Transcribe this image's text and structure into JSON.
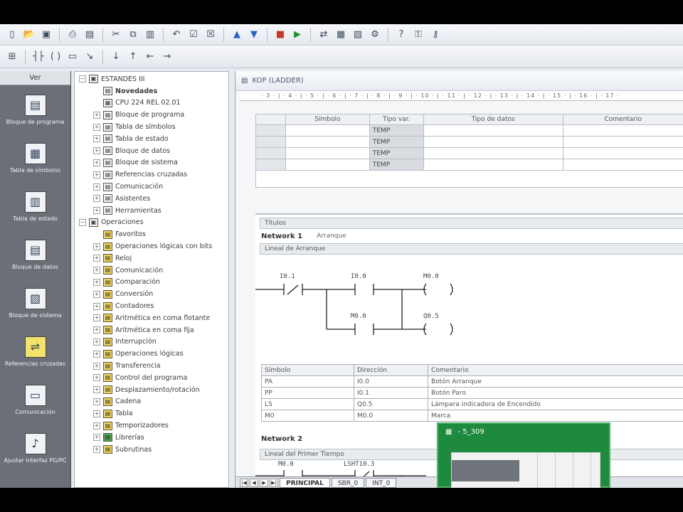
{
  "toolbar1": {
    "icons": [
      "new-icon",
      "open-icon",
      "save-icon",
      "print-icon",
      "preview-icon",
      "cut-icon",
      "copy-icon",
      "paste-icon",
      "undo-icon",
      "compile-icon",
      "compile-all-icon",
      "upload-icon",
      "download-icon",
      "stop-icon",
      "run-icon",
      "status-icon",
      "monitor-icon",
      "chart-icon",
      "options-icon",
      "help-icon",
      "lock-icon",
      "key-icon"
    ]
  },
  "toolbar2": {
    "icons": [
      "network-icon",
      "contact-icon",
      "coil-icon",
      "box-icon",
      "wire-icon",
      "down-line-icon",
      "up-line-icon",
      "left-line-icon",
      "right-line-icon"
    ]
  },
  "leftbar": {
    "header": "Ver",
    "items": [
      {
        "label": "Bloque de programa",
        "icon": "program-block-icon"
      },
      {
        "label": "Tabla de símbolos",
        "icon": "symbol-table-icon"
      },
      {
        "label": "Tabla de estado",
        "icon": "status-table-icon"
      },
      {
        "label": "Bloque de datos",
        "icon": "data-block-icon"
      },
      {
        "label": "Bloque de sistema",
        "icon": "system-block-icon"
      },
      {
        "label": "Referencias cruzadas",
        "icon": "cross-reference-icon"
      },
      {
        "label": "Comunicación",
        "icon": "communication-icon"
      },
      {
        "label": "Ajustar interfaz PG/PC",
        "icon": "pgpc-interface-icon"
      }
    ]
  },
  "tree": {
    "items": [
      {
        "text": "ESTANDES III",
        "exp": "⊟",
        "ico": "▣",
        "bold": false,
        "indent": 0
      },
      {
        "text": "Novedades",
        "exp": "",
        "ico": "▤",
        "bold": true,
        "indent": 1
      },
      {
        "text": "CPU 224 REL 02.01",
        "exp": "",
        "ico": "▦",
        "bold": false,
        "indent": 1
      },
      {
        "text": "Bloque de programa",
        "exp": "⊞",
        "ico": "▤",
        "bold": false,
        "indent": 1
      },
      {
        "text": "Tabla de símbolos",
        "exp": "⊞",
        "ico": "▤",
        "bold": false,
        "indent": 1
      },
      {
        "text": "Tabla de estado",
        "exp": "⊞",
        "ico": "▤",
        "bold": false,
        "indent": 1
      },
      {
        "text": "Bloque de datos",
        "exp": "⊞",
        "ico": "▤",
        "bold": false,
        "indent": 1
      },
      {
        "text": "Bloque de sistema",
        "exp": "⊞",
        "ico": "▤",
        "bold": false,
        "indent": 1
      },
      {
        "text": "Referencias cruzadas",
        "exp": "⊞",
        "ico": "▤",
        "bold": false,
        "indent": 1
      },
      {
        "text": "Comunicación",
        "exp": "⊞",
        "ico": "▤",
        "bold": false,
        "indent": 1
      },
      {
        "text": "Asistentes",
        "exp": "⊞",
        "ico": "▤",
        "bold": false,
        "indent": 1
      },
      {
        "text": "Herramientas",
        "exp": "⊞",
        "ico": "▤",
        "bold": false,
        "indent": 1
      },
      {
        "text": "Operaciones",
        "exp": "⊟",
        "ico": "▣",
        "bold": false,
        "indent": 0
      },
      {
        "text": "Favoritos",
        "exp": "",
        "ico": "▤",
        "bold": false,
        "indent": 1,
        "yellow": true
      },
      {
        "text": "Operaciones lógicas con bits",
        "exp": "⊞",
        "ico": "▤",
        "bold": false,
        "indent": 1,
        "yellow": true
      },
      {
        "text": "Reloj",
        "exp": "⊞",
        "ico": "▤",
        "bold": false,
        "indent": 1,
        "yellow": true
      },
      {
        "text": "Comunicación",
        "exp": "⊞",
        "ico": "▤",
        "bold": false,
        "indent": 1,
        "yellow": true
      },
      {
        "text": "Comparación",
        "exp": "⊞",
        "ico": "▤",
        "bold": false,
        "indent": 1,
        "yellow": true
      },
      {
        "text": "Conversión",
        "exp": "⊞",
        "ico": "▤",
        "bold": false,
        "indent": 1,
        "yellow": true
      },
      {
        "text": "Contadores",
        "exp": "⊞",
        "ico": "▤",
        "bold": false,
        "indent": 1,
        "yellow": true
      },
      {
        "text": "Aritmética en coma flotante",
        "exp": "⊞",
        "ico": "▤",
        "bold": false,
        "indent": 1,
        "yellow": true
      },
      {
        "text": "Aritmética en coma fija",
        "exp": "⊞",
        "ico": "▤",
        "bold": false,
        "indent": 1,
        "yellow": true
      },
      {
        "text": "Interrupción",
        "exp": "⊞",
        "ico": "▤",
        "bold": false,
        "indent": 1,
        "yellow": true
      },
      {
        "text": "Operaciones lógicas",
        "exp": "⊞",
        "ico": "▤",
        "bold": false,
        "indent": 1,
        "yellow": true
      },
      {
        "text": "Transferencia",
        "exp": "⊞",
        "ico": "▤",
        "bold": false,
        "indent": 1,
        "yellow": true
      },
      {
        "text": "Control del programa",
        "exp": "⊞",
        "ico": "▤",
        "bold": false,
        "indent": 1,
        "yellow": true
      },
      {
        "text": "Desplazamiento/rotación",
        "exp": "⊞",
        "ico": "▤",
        "bold": false,
        "indent": 1,
        "yellow": true
      },
      {
        "text": "Cadena",
        "exp": "⊞",
        "ico": "▤",
        "bold": false,
        "indent": 1,
        "yellow": true
      },
      {
        "text": "Tabla",
        "exp": "⊞",
        "ico": "▤",
        "bold": false,
        "indent": 1,
        "yellow": true
      },
      {
        "text": "Temporizadores",
        "exp": "⊞",
        "ico": "▤",
        "bold": false,
        "indent": 1,
        "yellow": true
      },
      {
        "text": "Librerías",
        "exp": "⊞",
        "ico": "▤",
        "bold": false,
        "indent": 1,
        "green": true
      },
      {
        "text": "Subrutinas",
        "exp": "⊞",
        "ico": "▤",
        "bold": false,
        "indent": 1,
        "yellow": true
      }
    ]
  },
  "editor": {
    "title": "KOP (LADDER)",
    "ruler": "· 3 · | · 4 · | · 5 · | · 6 · | · 7 · | · 8 · | · 9 · | · 10 · | · 11 · | · 12 · | · 13 · | · 14 · | · 15 · | · 16 · | · 17 ·",
    "var_headers": [
      "Símbolo",
      "Tipo var.",
      "Tipo de datos",
      "Comentario"
    ],
    "var_rows": [
      "TEMP",
      "TEMP",
      "TEMP",
      "TEMP"
    ],
    "program_band": "Títulos",
    "network1": {
      "title": "Network 1",
      "comment": "Arranque",
      "band": "Lineal de Arranque"
    },
    "contacts": {
      "c1": "I0.1",
      "c2": "I0.0",
      "c3": "M0.0",
      "coil1": "M0.0",
      "coil2": "Q0.5"
    },
    "symbol_headers": [
      "Símbolo",
      "Dirección",
      "Comentario"
    ],
    "symbol_rows": [
      {
        "sym": "PA",
        "addr": "I0.0",
        "comment": "Botón Arranque"
      },
      {
        "sym": "PP",
        "addr": "I0.1",
        "comment": "Botón Paro"
      },
      {
        "sym": "LS",
        "addr": "Q0.5",
        "comment": "Lámpara indicadora de Encendido"
      },
      {
        "sym": "M0",
        "addr": "M0.0",
        "comment": "Marca"
      }
    ],
    "network2": {
      "title": "Network 2",
      "band": "Lineal del Primer Tiempo"
    },
    "contacts2": {
      "c1": "M0.0",
      "c2": "LSHT10.3"
    },
    "tabs": [
      "PRINCIPAL",
      "SBR_0",
      "INT_0"
    ]
  },
  "popup": {
    "title": "- 5_309"
  }
}
